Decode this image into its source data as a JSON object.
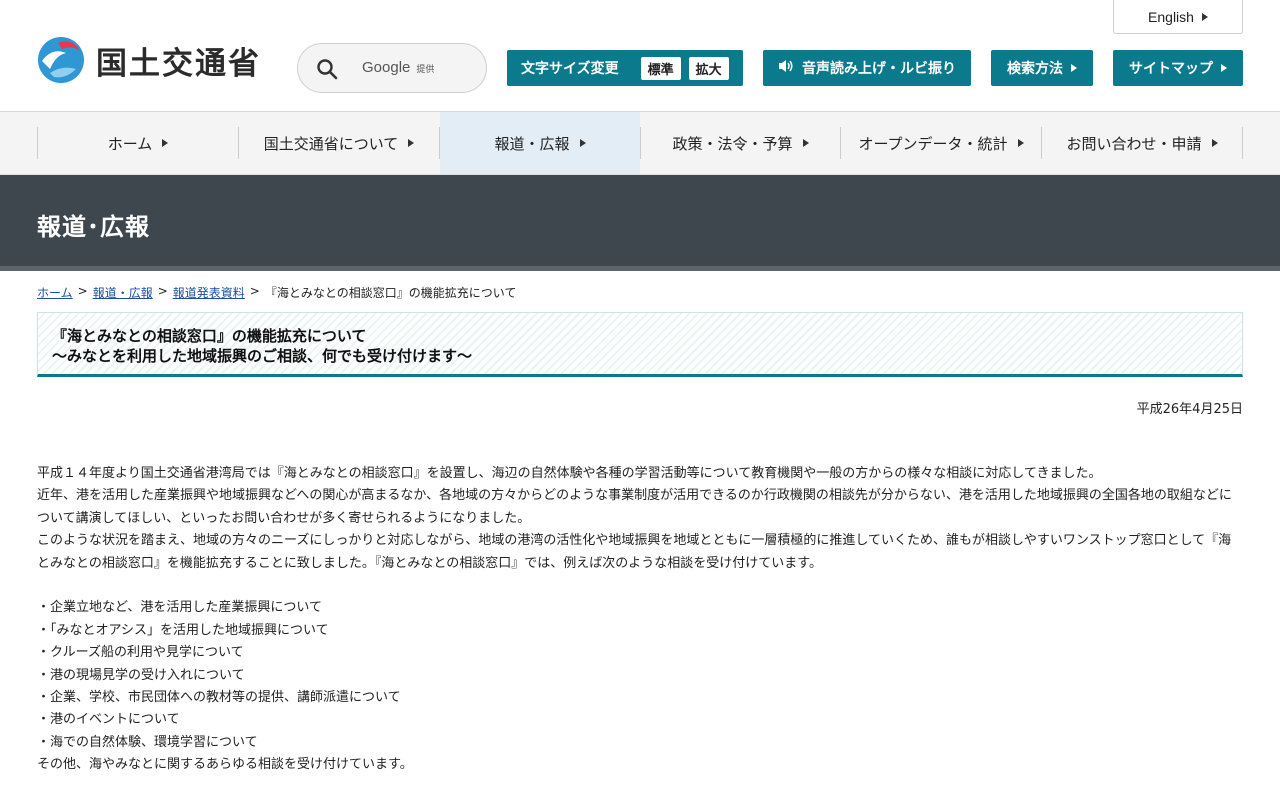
{
  "header": {
    "logo_text": "国土交通省",
    "search": {
      "brand": "Google",
      "sub": "提供"
    },
    "fontsize": {
      "label": "文字サイズ変更",
      "standard": "標準",
      "large": "拡大"
    },
    "voice_label": "音声読み上げ・ルビ振り",
    "howto_label": "検索方法",
    "sitemap_label": "サイトマップ",
    "english_label": "English"
  },
  "nav": {
    "items": [
      {
        "label": "ホーム"
      },
      {
        "label": "国土交通省について"
      },
      {
        "label": "報道・広報"
      },
      {
        "label": "政策・法令・予算"
      },
      {
        "label": "オープンデータ・統計"
      },
      {
        "label": "お問い合わせ・申請"
      }
    ]
  },
  "banner": {
    "title": "報道･広報"
  },
  "breadcrumb": {
    "home": "ホーム",
    "press": "報道・広報",
    "releases": "報道発表資料",
    "current": "『海とみなとの相談窓口』の機能拡充について",
    "sep": ">"
  },
  "article": {
    "title_line1": "『海とみなとの相談窓口』の機能拡充について",
    "title_line2": "～みなとを利用した地域振興のご相談、何でも受け付けます～",
    "date": "平成26年4月25日",
    "para1": "平成１４年度より国土交通省港湾局では『海とみなとの相談窓口』を設置し、海辺の自然体験や各種の学習活動等について教育機関や一般の方からの様々な相談に対応してきました。",
    "para2": "近年、港を活用した産業振興や地域振興などへの関心が高まるなか、各地域の方々からどのような事業制度が活用できるのか行政機関の相談先が分からない、港を活用した地域振興の全国各地の取組などについて講演してほしい、といったお問い合わせが多く寄せられるようになりました。",
    "para3": "このような状況を踏まえ、地域の方々のニーズにしっかりと対応しながら、地域の港湾の活性化や地域振興を地域とともに一層積極的に推進していくため、誰もが相談しやすいワンストップ窓口として『海とみなとの相談窓口』を機能拡充することに致しました。『海とみなとの相談窓口』では、例えば次のような相談を受け付けています。",
    "bullets": [
      "・企業立地など、港を活用した産業振興について",
      "・「みなとオアシス」を活用した地域振興について",
      "・クルーズ船の利用や見学について",
      "・港の現場見学の受け入れについて",
      "・企業、学校、市民団体への教材等の提供、講師派遣について",
      "・港のイベントについて",
      "・海での自然体験、環境学習について"
    ],
    "closing": "その他、海やみなとに関するあらゆる相談を受け付けています。"
  },
  "colors": {
    "accent": "#0a7a8c",
    "banner": "#3d474d",
    "nav_active": "#e2edf6",
    "link": "#1a4fa0"
  }
}
